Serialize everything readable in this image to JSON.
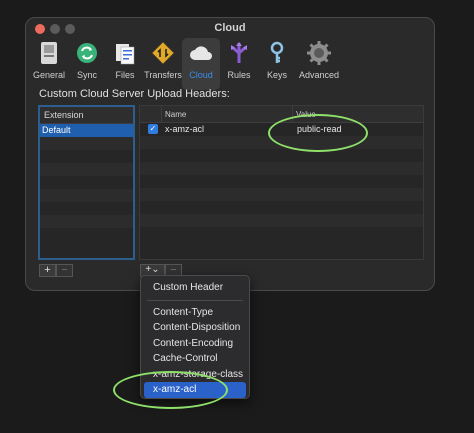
{
  "window": {
    "title": "Cloud"
  },
  "toolbar": {
    "items": [
      {
        "label": "General",
        "icon": "general-icon"
      },
      {
        "label": "Sync",
        "icon": "sync-icon"
      },
      {
        "label": "Files",
        "icon": "files-icon"
      },
      {
        "label": "Transfers",
        "icon": "transfers-icon"
      },
      {
        "label": "Cloud",
        "icon": "cloud-icon",
        "active": true
      },
      {
        "label": "Rules",
        "icon": "rules-icon"
      },
      {
        "label": "Keys",
        "icon": "keys-icon"
      },
      {
        "label": "Advanced",
        "icon": "advanced-icon"
      }
    ]
  },
  "section": {
    "title": "Custom Cloud Server Upload Headers:"
  },
  "extensions": {
    "header": "Extension",
    "rows": [
      "Default"
    ]
  },
  "headers_table": {
    "columns": {
      "name": "Name",
      "value": "Value"
    },
    "rows": [
      {
        "checked": true,
        "name": "x-amz-acl",
        "value": "public-read"
      }
    ]
  },
  "buttons": {
    "add": "+",
    "remove": "−",
    "add_menu": "+⌄"
  },
  "dropdown": {
    "custom": "Custom Header",
    "items": [
      "Content-Type",
      "Content-Disposition",
      "Content-Encoding",
      "Cache-Control",
      "x-amz-storage-class",
      "x-amz-acl"
    ],
    "selected": "x-amz-acl"
  },
  "colors": {
    "accent": "#2a62c9",
    "annotation": "#8fe06a",
    "selection_border": "#2e5e8e"
  }
}
